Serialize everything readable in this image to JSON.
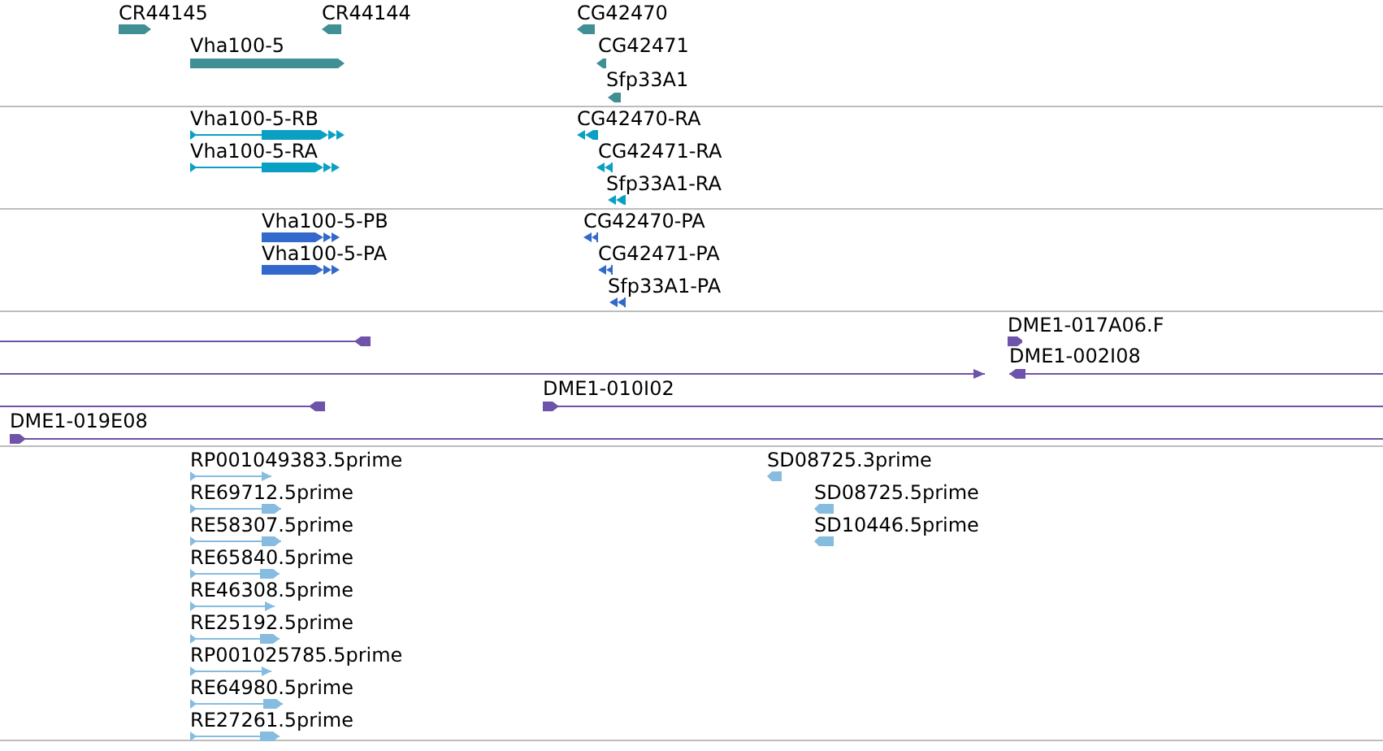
{
  "tracks": [
    {
      "kind": "gene",
      "color": "#3f8f94",
      "features": [
        {
          "label": "CR44145",
          "reverse": false
        },
        {
          "label": "CR44144",
          "reverse": true
        },
        {
          "label": "Vha100-5",
          "reverse": false
        },
        {
          "label": "CG42470",
          "reverse": true
        },
        {
          "label": "CG42471",
          "reverse": true
        },
        {
          "label": "Sfp33A1",
          "reverse": true
        }
      ]
    },
    {
      "kind": "transcript",
      "color": "#0aa0c4",
      "features": [
        {
          "label": "Vha100-5-RB",
          "reverse": false
        },
        {
          "label": "Vha100-5-RA",
          "reverse": false
        },
        {
          "label": "CG42470-RA",
          "reverse": true
        },
        {
          "label": "CG42471-RA",
          "reverse": true
        },
        {
          "label": "Sfp33A1-RA",
          "reverse": true
        }
      ]
    },
    {
      "kind": "transcript",
      "color": "#3369cc",
      "features": [
        {
          "label": "Vha100-5-PB",
          "reverse": false
        },
        {
          "label": "Vha100-5-PA",
          "reverse": false
        },
        {
          "label": "CG42470-PA",
          "reverse": true
        },
        {
          "label": "CG42471-PA",
          "reverse": true
        },
        {
          "label": "Sfp33A1-PA",
          "reverse": true
        }
      ]
    },
    {
      "kind": "clone",
      "color": "#6f52a9",
      "features": [
        {
          "reverse": true
        },
        {
          "label": "DME1-017A06.F",
          "reverse": false
        },
        {
          "reverse": false
        },
        {
          "label": "DME1-002I08",
          "reverse": true
        },
        {
          "reverse": true
        },
        {
          "label": "DME1-010I02",
          "reverse": false
        },
        {
          "label": "DME1-019E08",
          "reverse": false
        }
      ]
    },
    {
      "kind": "est",
      "color": "#86bce0",
      "features": [
        {
          "label": "RP001049383.5prime",
          "reverse": false
        },
        {
          "label": "RE69712.5prime",
          "reverse": false
        },
        {
          "label": "RE58307.5prime",
          "reverse": false
        },
        {
          "label": "RE65840.5prime",
          "reverse": false
        },
        {
          "label": "RE46308.5prime",
          "reverse": false
        },
        {
          "label": "RE25192.5prime",
          "reverse": false
        },
        {
          "label": "RP001025785.5prime",
          "reverse": false
        },
        {
          "label": "RE64980.5prime",
          "reverse": false
        },
        {
          "label": "RE27261.5prime",
          "reverse": false
        },
        {
          "label": "SD08725.3prime",
          "reverse": true
        },
        {
          "label": "SD08725.5prime",
          "reverse": true
        },
        {
          "label": "SD10446.5prime",
          "reverse": true
        }
      ]
    }
  ]
}
